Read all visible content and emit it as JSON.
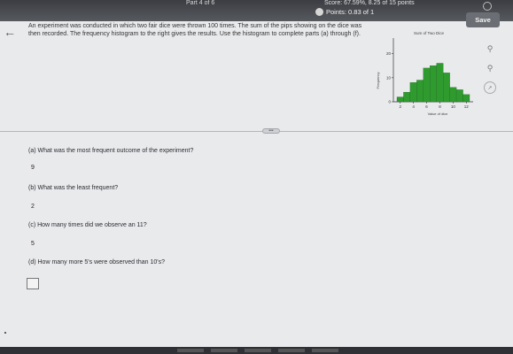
{
  "header": {
    "part": "Part 4 of 6",
    "score": "Score: 67.59%, 8.25 of 15 points",
    "points": "Points: 0.83 of 1",
    "save_label": "Save"
  },
  "problem": {
    "text": "An experiment was conducted in which two fair dice were thrown 100 times. The sum of the pips showing on the dice was then recorded. The frequency histogram to the right gives the results. Use the histogram to complete parts (a) through (f)."
  },
  "chart_data": {
    "type": "bar",
    "title": "Sum of Two Dice",
    "xlabel": "Value of dice",
    "ylabel": "Frequency",
    "categories": [
      "2",
      "3",
      "4",
      "5",
      "6",
      "7",
      "8",
      "9",
      "10",
      "11",
      "12"
    ],
    "values": [
      2,
      4,
      8,
      9,
      14,
      15,
      16,
      12,
      6,
      5,
      3
    ],
    "x_ticks": [
      "2",
      "4",
      "6",
      "8",
      "10",
      "12"
    ],
    "y_ticks": [
      "0",
      "10",
      "20"
    ],
    "ylim": [
      0,
      25
    ],
    "bar_color": "#2f9b2f"
  },
  "questions": [
    {
      "label": "(a) What was the most frequent outcome of the experiment?",
      "answer": "9"
    },
    {
      "label": "(b) What was the least frequent?",
      "answer": "2"
    },
    {
      "label": "(c) How many times did we observe an 11?",
      "answer": "5"
    },
    {
      "label": "(d) How many more 5's were observed than 10's?",
      "answer": ""
    }
  ],
  "divider_handle": "•••",
  "icons": {
    "back": "left-arrow-icon",
    "zoom_in": "zoom-in-icon",
    "zoom_out": "zoom-out-icon",
    "help": "help-icon"
  }
}
